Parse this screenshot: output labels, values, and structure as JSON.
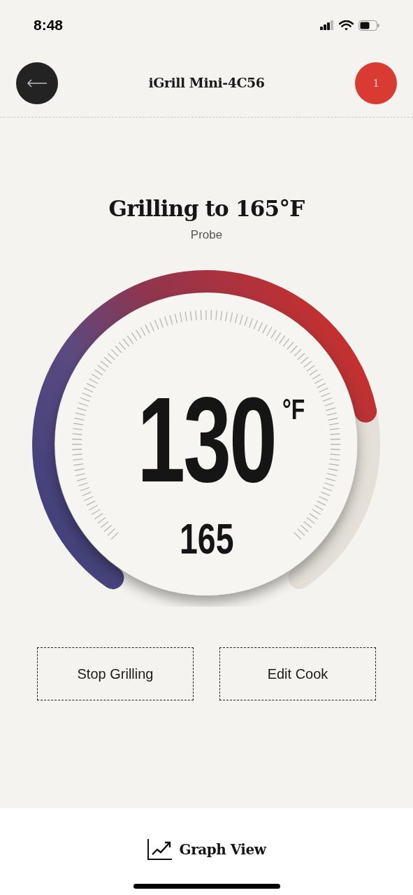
{
  "status_bar": {
    "time": "8:48"
  },
  "header": {
    "title": "iGrill Mini-4C56",
    "badge": "1"
  },
  "cook": {
    "title": "Grilling to 165°F",
    "probe": "Probe"
  },
  "gauge": {
    "temperature": "130",
    "unit": "°F",
    "target": "165"
  },
  "buttons": [
    {
      "label": "Stop Grilling"
    },
    {
      "label": "Edit Cook"
    }
  ],
  "footer": {
    "label": "Graph View"
  }
}
